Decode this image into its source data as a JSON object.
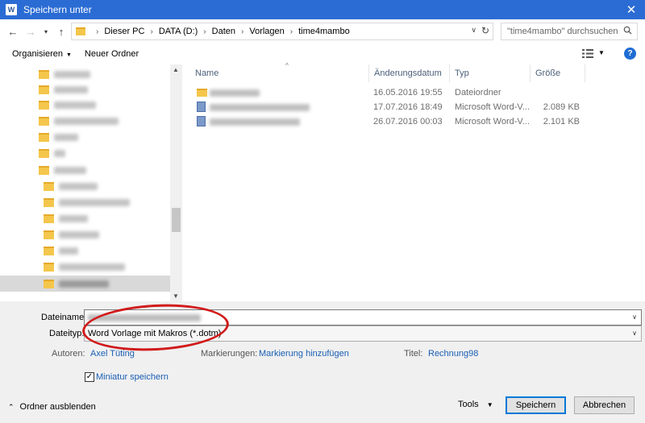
{
  "window": {
    "title": "Speichern unter",
    "app_icon": "W",
    "close_glyph": "✕"
  },
  "address": {
    "breadcrumbs": [
      "Dieser PC",
      "DATA (D:)",
      "Daten",
      "Vorlagen",
      "time4mambo"
    ],
    "search_placeholder": "\"time4mambo\" durchsuchen"
  },
  "toolbar": {
    "organize": "Organisieren",
    "new_folder": "Neuer Ordner",
    "help": "?"
  },
  "columns": {
    "name": "Name",
    "date": "Änderungsdatum",
    "type": "Typ",
    "size": "Größe"
  },
  "files": [
    {
      "icon": "folder-icon",
      "date": "16.05.2016 19:55",
      "type": "Dateiordner",
      "size": ""
    },
    {
      "icon": "word-template-icon",
      "date": "17.07.2016 18:49",
      "type": "Microsoft Word-V...",
      "size": "2.089 KB"
    },
    {
      "icon": "word-template-icon",
      "date": "26.07.2016 00:03",
      "type": "Microsoft Word-V...",
      "size": "2.101 KB"
    }
  ],
  "form": {
    "filename_label": "Dateiname:",
    "filetype_label": "Dateityp:",
    "filetype_value": "Word Vorlage mit Makros (*.dotm)",
    "authors_label": "Autoren:",
    "authors_value": "Axel Tüting",
    "tags_label": "Markierungen:",
    "tags_value": "Markierung hinzufügen",
    "title_label": "Titel:",
    "title_value": "Rechnung98",
    "thumbnail_label": "Miniatur speichern",
    "thumbnail_checked": true
  },
  "footer": {
    "hide_folders": "Ordner ausblenden",
    "tools": "Tools",
    "save": "Speichern",
    "cancel": "Abbrechen"
  },
  "colors": {
    "titlebar": "#2b6cd4",
    "annotation": "#d11b1b",
    "link": "#1a5fb4"
  }
}
